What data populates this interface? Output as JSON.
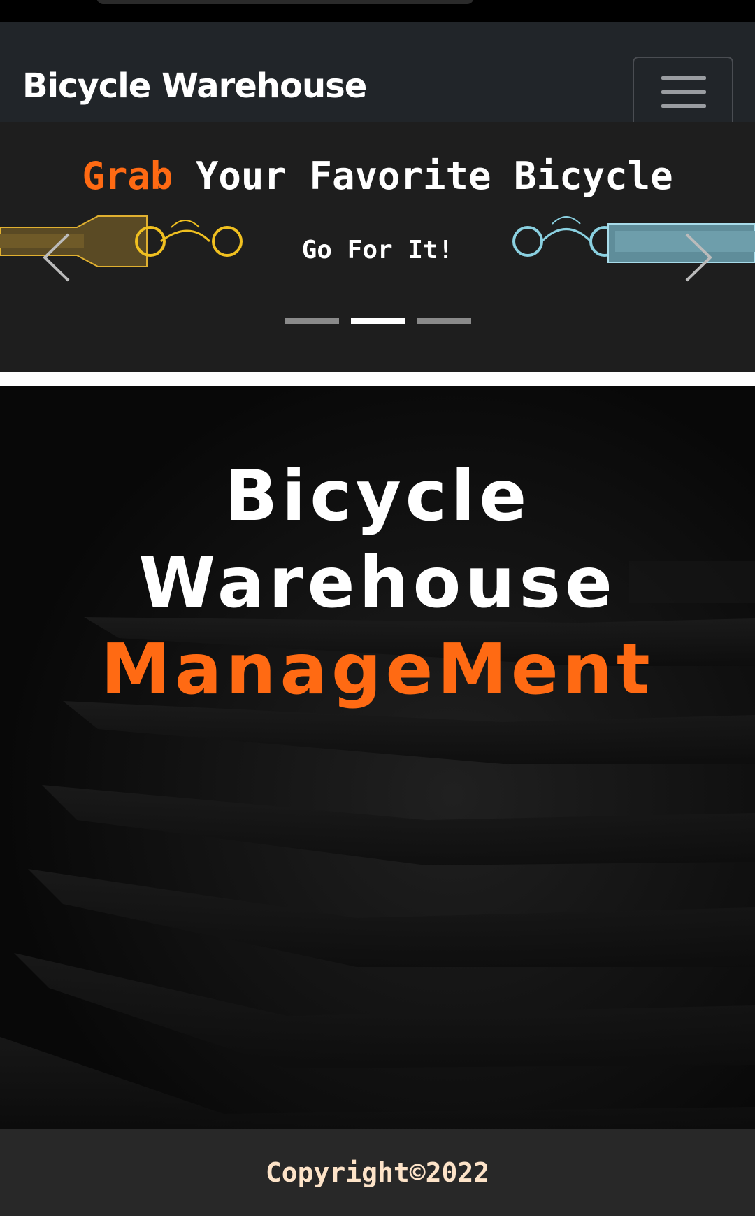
{
  "navbar": {
    "brand": "Bicycle Warehouse",
    "toggler_icon": "hamburger-menu-icon"
  },
  "carousel": {
    "title_accent": "Grab",
    "title_rest": " Your Favorite Bicycle",
    "subtitle": "Go For It!",
    "prev_icon": "chevron-left-icon",
    "next_icon": "chevron-right-icon",
    "slide_count": 3,
    "active_slide": 2
  },
  "hero": {
    "line1": "Bicycle",
    "line2": "Warehouse",
    "line3": "ManageMent"
  },
  "footer": {
    "copyright": "Copyright©2022"
  },
  "colors": {
    "accent": "#ff6a13",
    "navbar_bg": "#212529",
    "footer_bg": "#282828",
    "footer_text": "#fde3c8"
  }
}
